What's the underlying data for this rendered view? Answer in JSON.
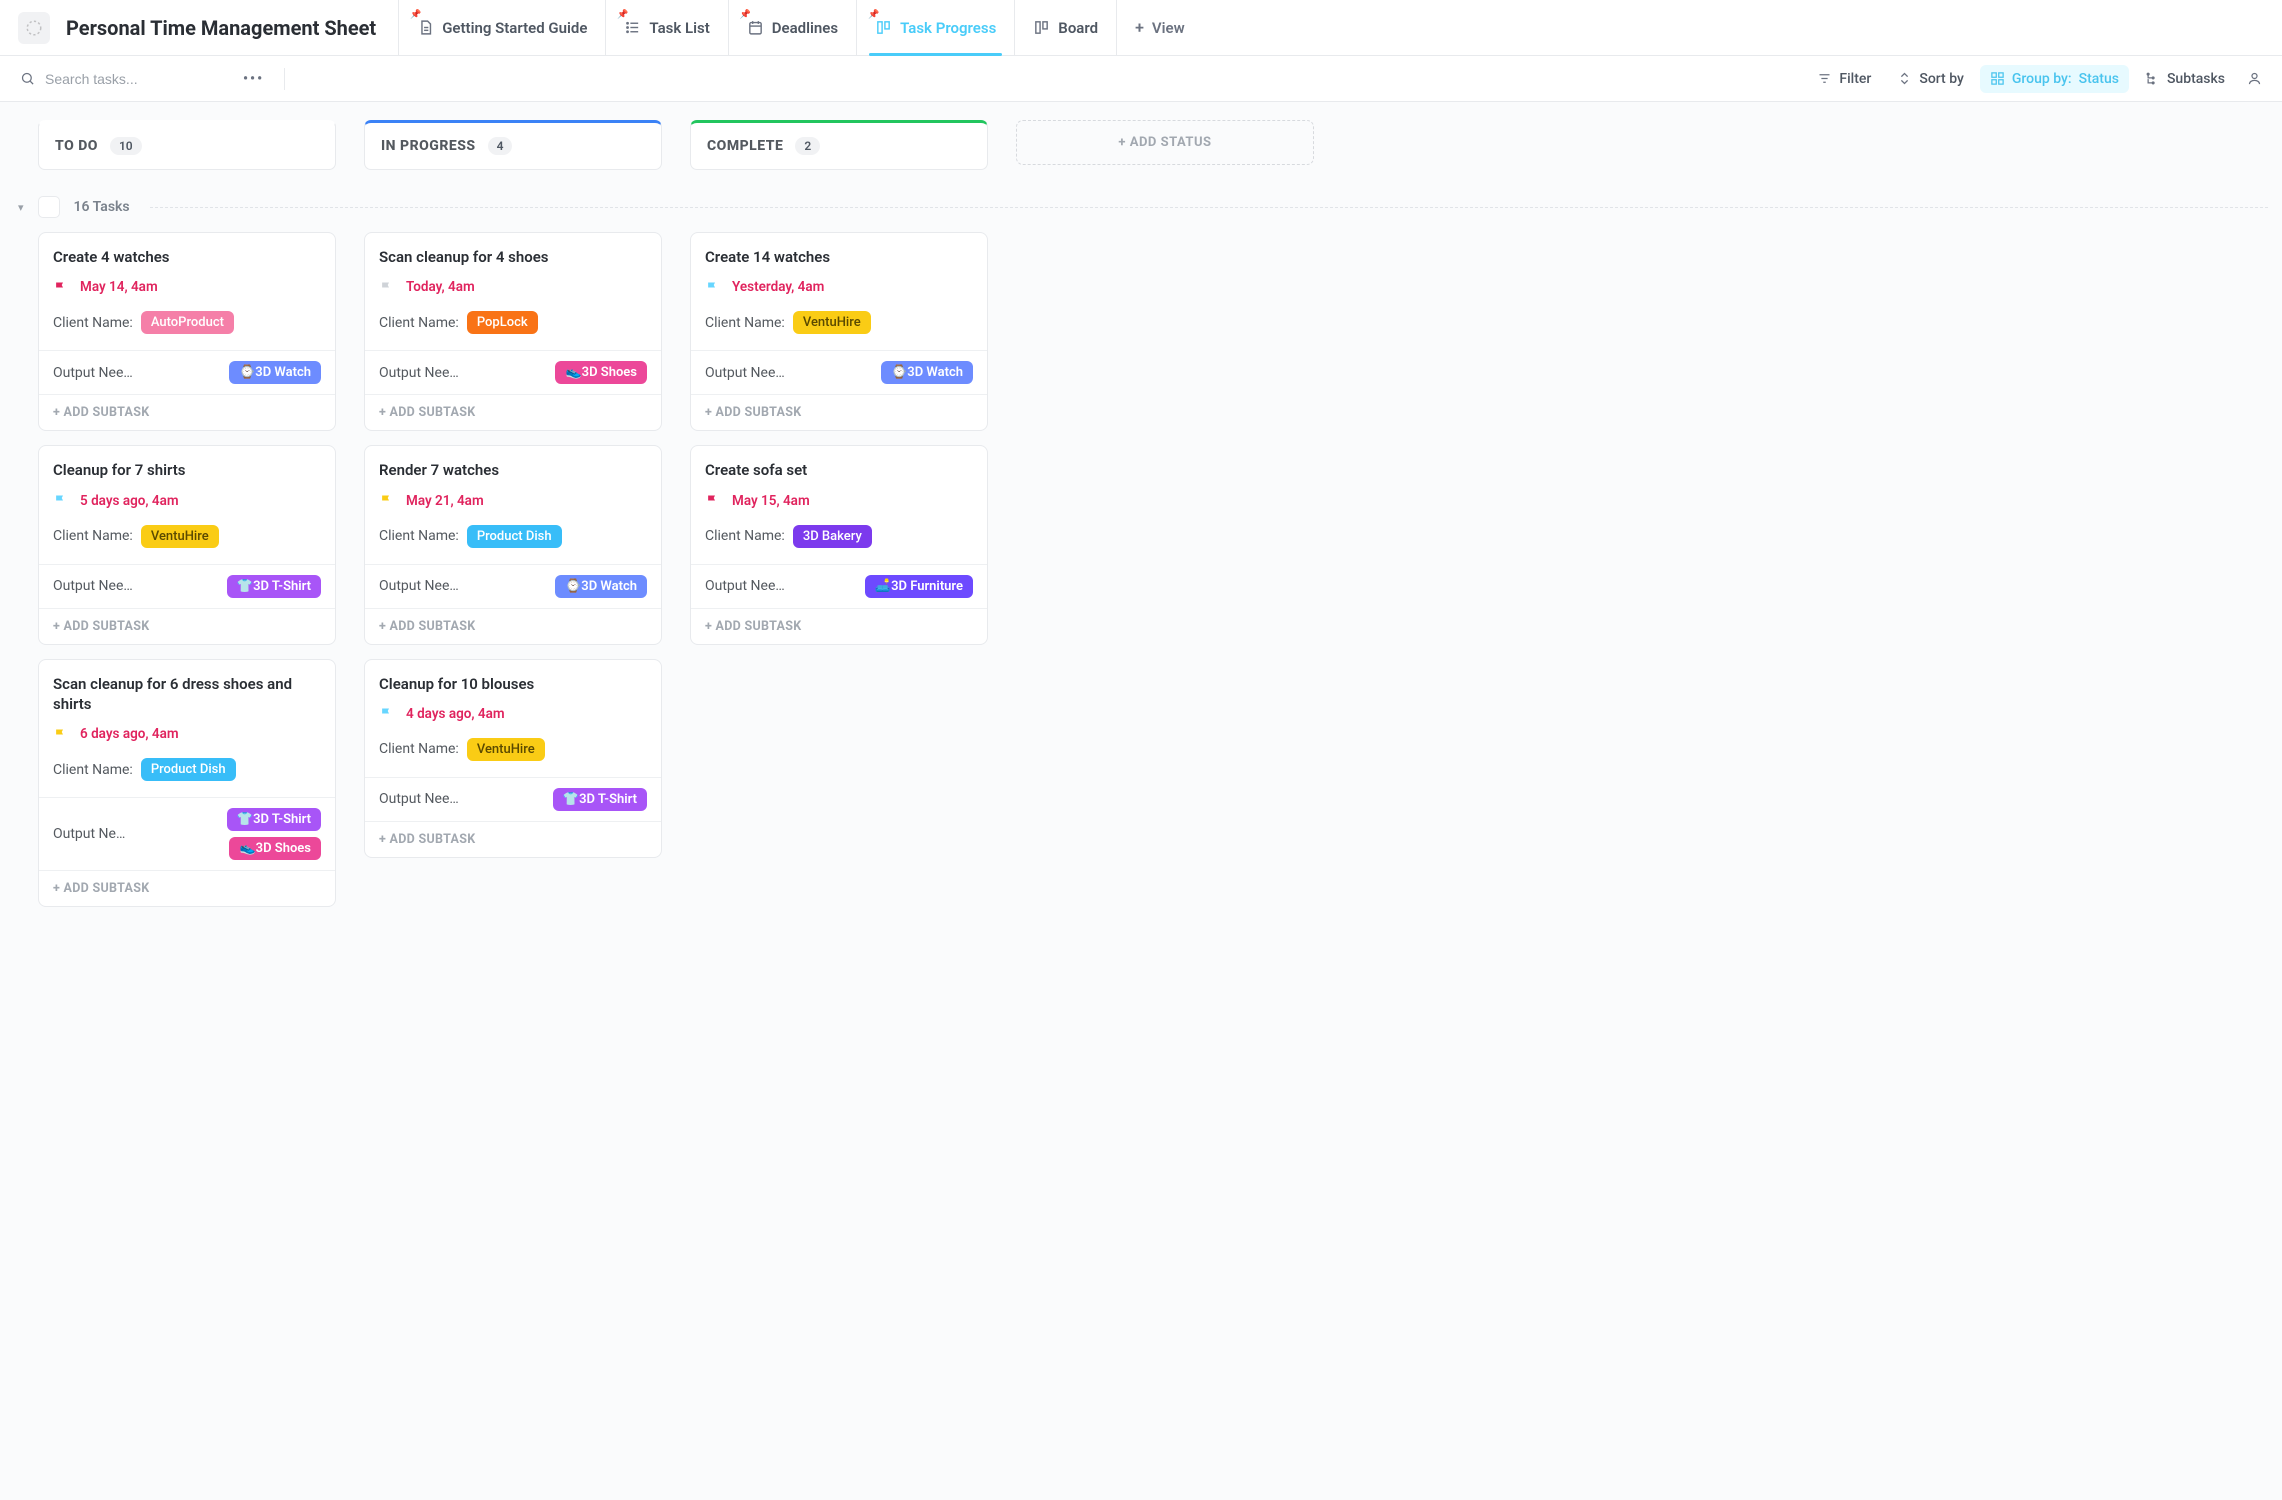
{
  "header": {
    "title": "Personal Time Management Sheet",
    "views": [
      {
        "label": "Getting Started Guide",
        "icon": "doc",
        "pinned": true,
        "active": false
      },
      {
        "label": "Task List",
        "icon": "list",
        "pinned": true,
        "active": false
      },
      {
        "label": "Deadlines",
        "icon": "cal",
        "pinned": true,
        "active": false
      },
      {
        "label": "Task Progress",
        "icon": "board",
        "pinned": true,
        "active": true
      },
      {
        "label": "Board",
        "icon": "board",
        "pinned": false,
        "active": false
      }
    ],
    "add_view_label": "View"
  },
  "toolbar": {
    "search_placeholder": "Search tasks...",
    "filter_label": "Filter",
    "sort_label": "Sort by",
    "group_label": "Group by:",
    "group_value": "Status",
    "subtasks_label": "Subtasks"
  },
  "board": {
    "statuses": [
      {
        "key": "todo",
        "label": "TO DO",
        "count": 10
      },
      {
        "key": "inprogress",
        "label": "IN PROGRESS",
        "count": 4
      },
      {
        "key": "complete",
        "label": "COMPLETE",
        "count": 2
      }
    ],
    "add_status_label": "+ ADD STATUS",
    "group_title": "16 Tasks",
    "output_label": "Output Nee…",
    "client_label": "Client Name:",
    "add_subtask_label": "+ ADD SUBTASK",
    "columns": {
      "todo": [
        {
          "title": "Create 4 watches",
          "flag": "red",
          "due": "May 14, 4am",
          "client": {
            "name": "AutoProduct",
            "cls": "c-autoproduct"
          },
          "outputs": [
            {
              "emoji": "⌚",
              "name": "3D Watch",
              "cls": "t-3dwatch"
            }
          ]
        },
        {
          "title": "Cleanup for 7 shirts",
          "flag": "cyan",
          "due": "5 days ago, 4am",
          "client": {
            "name": "VentuHire",
            "cls": "c-ventuhire"
          },
          "outputs": [
            {
              "emoji": "👕",
              "name": "3D T-Shirt",
              "cls": "t-3dtshirt"
            }
          ]
        },
        {
          "title": "Scan cleanup for 6 dress shoes and shirts",
          "flag": "yellow",
          "due": "6 days ago, 4am",
          "client": {
            "name": "Product Dish",
            "cls": "c-productdish"
          },
          "outputs": [
            {
              "emoji": "👕",
              "name": "3D T-Shirt",
              "cls": "t-3dtshirt"
            },
            {
              "emoji": "👟",
              "name": "3D Shoes",
              "cls": "t-3dshoes"
            }
          ]
        }
      ],
      "inprogress": [
        {
          "title": "Scan cleanup for 4 shoes",
          "flag": "grey",
          "due": "Today, 4am",
          "client": {
            "name": "PopLock",
            "cls": "c-poplock"
          },
          "outputs": [
            {
              "emoji": "👟",
              "name": "3D Shoes",
              "cls": "t-3dshoes"
            }
          ]
        },
        {
          "title": "Render 7 watches",
          "flag": "yellow",
          "due": "May 21, 4am",
          "client": {
            "name": "Product Dish",
            "cls": "c-productdish"
          },
          "outputs": [
            {
              "emoji": "⌚",
              "name": "3D Watch",
              "cls": "t-3dwatch"
            }
          ]
        },
        {
          "title": "Cleanup for 10 blouses",
          "flag": "cyan",
          "due": "4 days ago, 4am",
          "client": {
            "name": "VentuHire",
            "cls": "c-ventuhire"
          },
          "outputs": [
            {
              "emoji": "👕",
              "name": "3D T-Shirt",
              "cls": "t-3dtshirt"
            }
          ]
        }
      ],
      "complete": [
        {
          "title": "Create 14 watches",
          "flag": "cyan",
          "due": "Yesterday, 4am",
          "client": {
            "name": "VentuHire",
            "cls": "c-ventuhire"
          },
          "outputs": [
            {
              "emoji": "⌚",
              "name": "3D Watch",
              "cls": "t-3dwatch"
            }
          ]
        },
        {
          "title": "Create sofa set",
          "flag": "red",
          "due": "May 15, 4am",
          "client": {
            "name": "3D Bakery",
            "cls": "c-3dbakery"
          },
          "outputs": [
            {
              "emoji": "🛋️",
              "name": "3D Furniture",
              "cls": "t-3dfurniture"
            }
          ]
        }
      ]
    }
  }
}
